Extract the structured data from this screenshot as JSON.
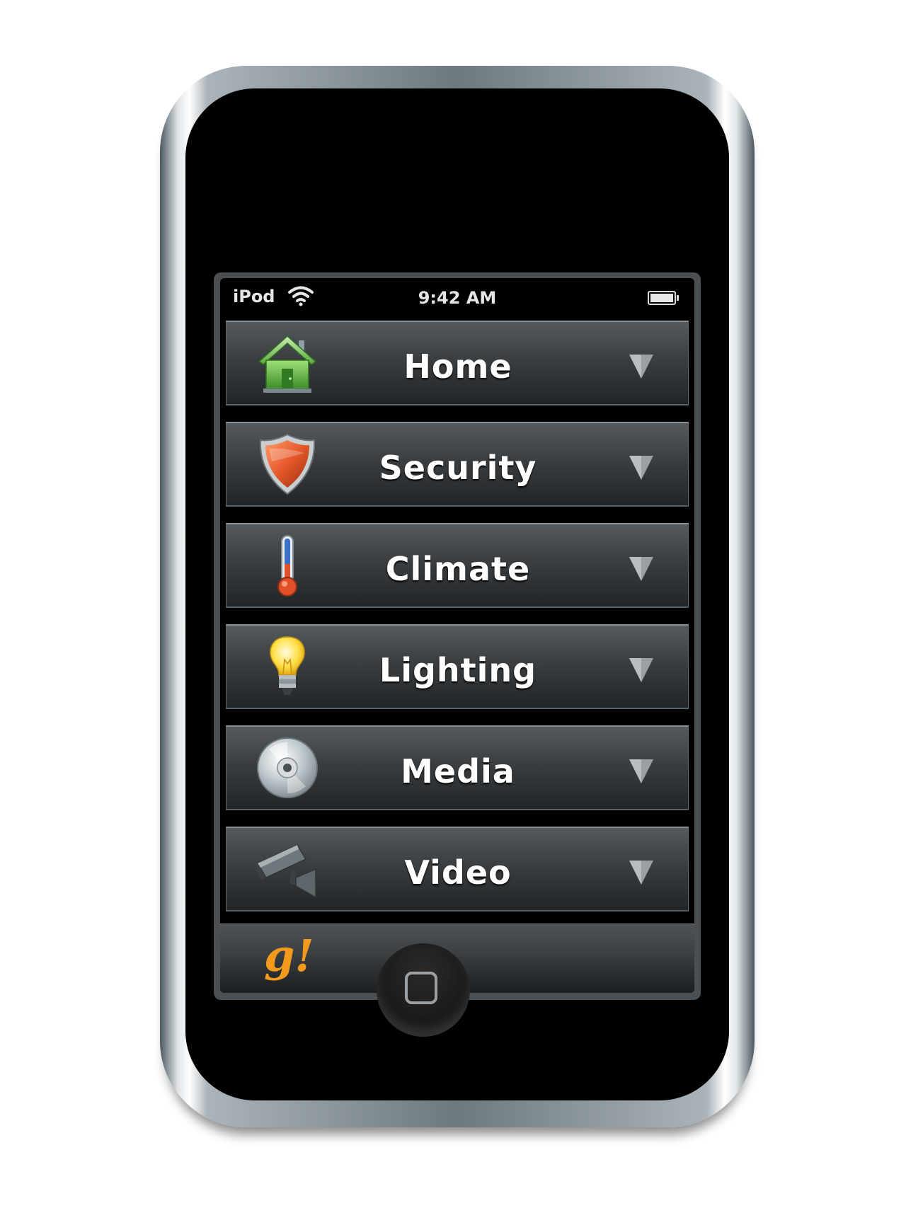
{
  "status_bar": {
    "carrier": "iPod",
    "wifi_icon": "wifi-icon",
    "time": "9:42 AM",
    "battery_icon": "battery-icon",
    "battery_level": 1.0
  },
  "menu": {
    "items": [
      {
        "label": "Home",
        "icon": "house-icon"
      },
      {
        "label": "Security",
        "icon": "shield-icon"
      },
      {
        "label": "Climate",
        "icon": "thermometer-icon"
      },
      {
        "label": "Lighting",
        "icon": "light-bulb-icon"
      },
      {
        "label": "Media",
        "icon": "disc-icon"
      },
      {
        "label": "Video",
        "icon": "security-camera-icon"
      }
    ],
    "chevron_icon": "chevron-down-icon"
  },
  "footer": {
    "logo_text": "g!",
    "logo_color": "#f39a1c"
  },
  "device": {
    "home_button_icon": "home-button-icon"
  }
}
